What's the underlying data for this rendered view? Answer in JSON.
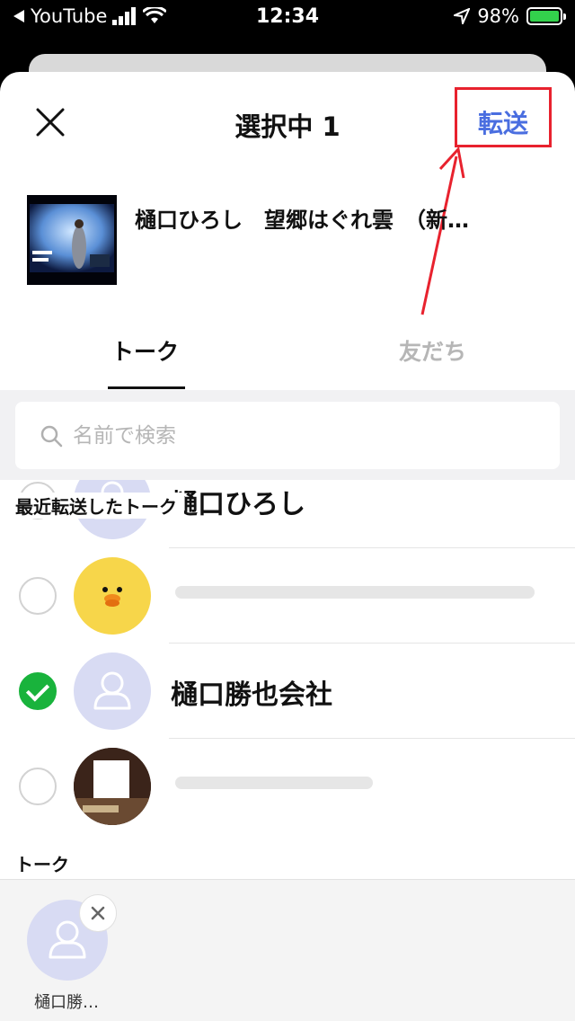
{
  "status_bar": {
    "back_app": "YouTube",
    "time": "12:34",
    "battery": "98%"
  },
  "header": {
    "title": "選択中 1",
    "send_label": "転送",
    "close_icon": "close-icon"
  },
  "preview": {
    "title": "樋口ひろし　望郷はぐれ雲　（新…"
  },
  "tabs": [
    {
      "label": "トーク",
      "active": true
    },
    {
      "label": "友だち",
      "active": false
    }
  ],
  "search": {
    "placeholder": "名前で検索"
  },
  "section": {
    "recent_label": "最近転送したトーク",
    "talk_label": "トーク"
  },
  "contacts": [
    {
      "name": "樋口ひろし",
      "checked": false
    },
    {
      "name": "",
      "checked": false
    },
    {
      "name": "樋口勝也会社",
      "checked": true
    },
    {
      "name": "",
      "checked": false
    }
  ],
  "selected": {
    "name": "樋口勝…"
  },
  "colors": {
    "accent": "#4a6ee0",
    "check_green": "#19b33c",
    "annotation_red": "#e8222e",
    "avatar_bg": "#d8dbf3"
  }
}
